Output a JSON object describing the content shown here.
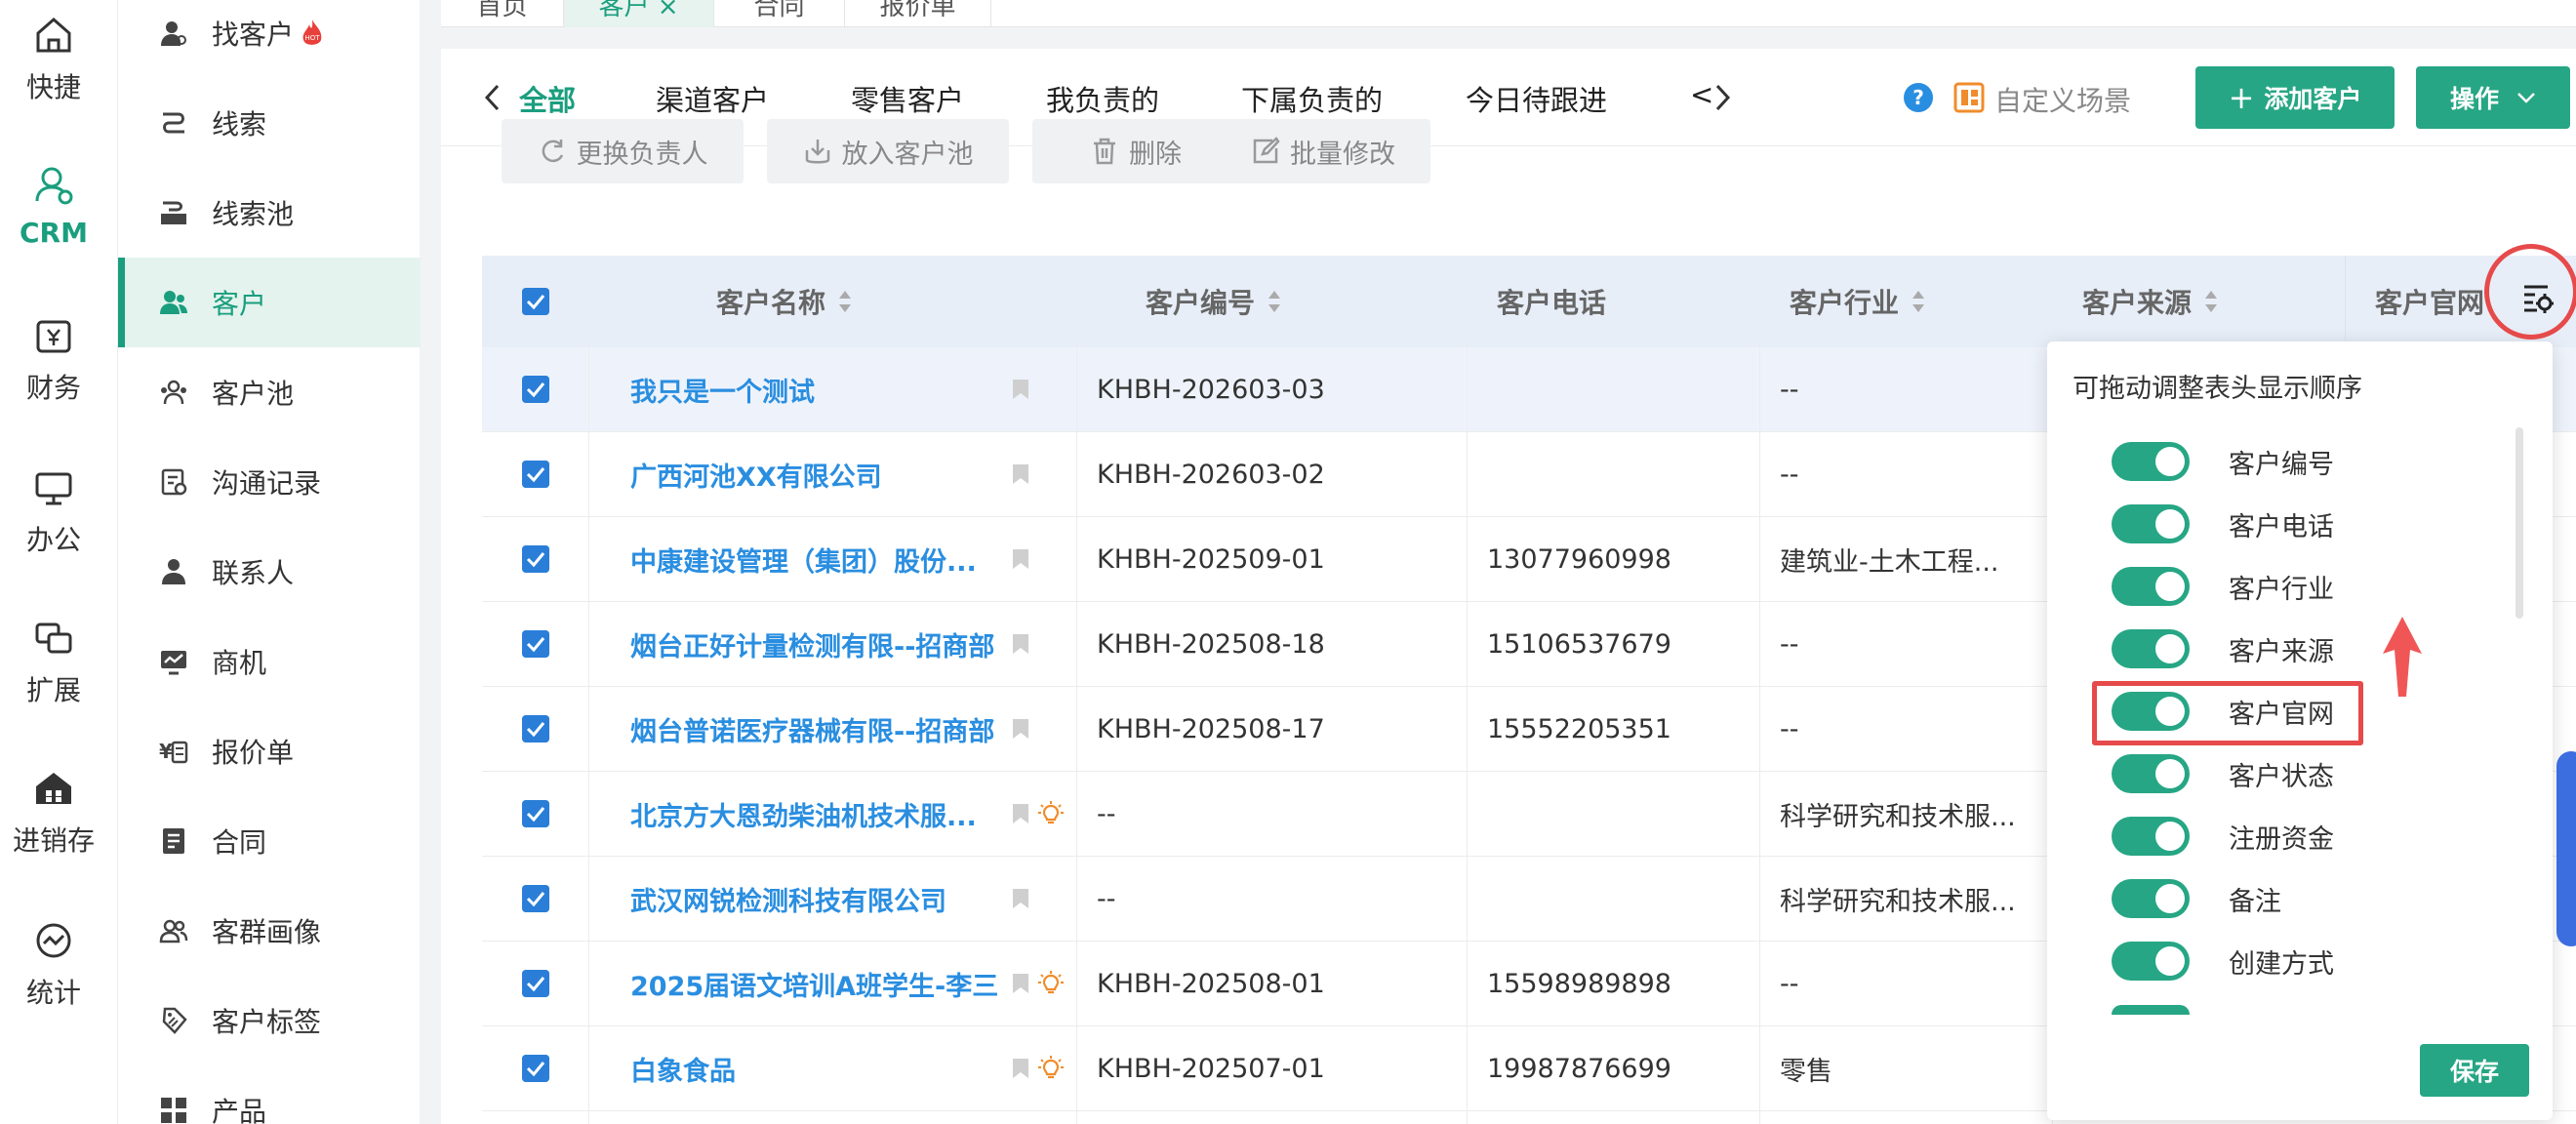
{
  "rail": {
    "items": [
      {
        "label": "快捷",
        "icon": "home-icon"
      },
      {
        "label": "CRM",
        "icon": "crm-icon",
        "active": true
      },
      {
        "label": "财务",
        "icon": "finance-icon"
      },
      {
        "label": "办公",
        "icon": "office-icon"
      },
      {
        "label": "扩展",
        "icon": "extend-icon"
      },
      {
        "label": "进销存",
        "icon": "inventory-icon"
      },
      {
        "label": "统计",
        "icon": "stats-icon"
      }
    ]
  },
  "sidebar": {
    "items": [
      {
        "label": "找客户",
        "icon": "find-customer-icon",
        "badge": "hot-icon"
      },
      {
        "label": "线索",
        "icon": "lead-icon"
      },
      {
        "label": "线索池",
        "icon": "lead-pool-icon"
      },
      {
        "label": "客户",
        "icon": "customer-icon",
        "active": true
      },
      {
        "label": "客户池",
        "icon": "customer-pool-icon"
      },
      {
        "label": "沟通记录",
        "icon": "communication-icon"
      },
      {
        "label": "联系人",
        "icon": "contact-icon"
      },
      {
        "label": "商机",
        "icon": "opportunity-icon"
      },
      {
        "label": "报价单",
        "icon": "quote-icon"
      },
      {
        "label": "合同",
        "icon": "contract-icon"
      },
      {
        "label": "客群画像",
        "icon": "persona-icon"
      },
      {
        "label": "客户标签",
        "icon": "tag-icon"
      },
      {
        "label": "产品",
        "icon": "product-icon"
      }
    ]
  },
  "top_tabs": [
    {
      "label": "首页"
    },
    {
      "label": "客户",
      "close": "×",
      "active": true
    },
    {
      "label": "合同"
    },
    {
      "label": "报价单"
    }
  ],
  "scenes": {
    "items": [
      "全部",
      "渠道客户",
      "零售客户",
      "我负责的",
      "下属负责的",
      "今日待跟进",
      "<"
    ],
    "active": "全部",
    "custom_scene_label": "自定义场景",
    "add_button": "添加客户",
    "operate_button": "操作"
  },
  "toolbar": {
    "change_owner": "更换负责人",
    "move_to_pool": "放入客户池",
    "delete": "删除",
    "batch_edit": "批量修改"
  },
  "table": {
    "columns": [
      "客户名称",
      "客户编号",
      "客户电话",
      "客户行业",
      "客户来源",
      "客户官网"
    ],
    "rows": [
      {
        "name": "我只是一个测试",
        "code": "KHBH-202603-03",
        "phone": "",
        "industry": "--",
        "bulb": false
      },
      {
        "name": "广西河池XX有限公司",
        "code": "KHBH-202603-02",
        "phone": "",
        "industry": "--",
        "bulb": false
      },
      {
        "name": "中康建设管理（集团）股份...",
        "code": "KHBH-202509-01",
        "phone": "13077960998",
        "industry": "建筑业-土木工程...",
        "bulb": false
      },
      {
        "name": "烟台正好计量检测有限--招商部",
        "code": "KHBH-202508-18",
        "phone": "15106537679",
        "industry": "--",
        "bulb": false
      },
      {
        "name": "烟台普诺医疗器械有限--招商部",
        "code": "KHBH-202508-17",
        "phone": "15552205351",
        "industry": "--",
        "bulb": false
      },
      {
        "name": "北京方大恩劲柴油机技术服...",
        "code": "--",
        "phone": "",
        "industry": "科学研究和技术服...",
        "bulb": true
      },
      {
        "name": "武汉网锐检测科技有限公司",
        "code": "--",
        "phone": "",
        "industry": "科学研究和技术服...",
        "bulb": false
      },
      {
        "name": "2025届语文培训A班学生-李三",
        "code": "KHBH-202508-01",
        "phone": "15598989898",
        "industry": "--",
        "bulb": true
      },
      {
        "name": "白象食品",
        "code": "KHBH-202507-01",
        "phone": "19987876699",
        "industry": "零售",
        "bulb": true
      }
    ]
  },
  "column_settings": {
    "title": "可拖动调整表头显示顺序",
    "items": [
      "客户编号",
      "客户电话",
      "客户行业",
      "客户来源",
      "客户官网",
      "客户状态",
      "注册资金",
      "备注",
      "创建方式"
    ],
    "save": "保存"
  },
  "colors": {
    "brand": "#26a684",
    "link": "#2a8ee0",
    "annotation": "#e64a4a"
  }
}
